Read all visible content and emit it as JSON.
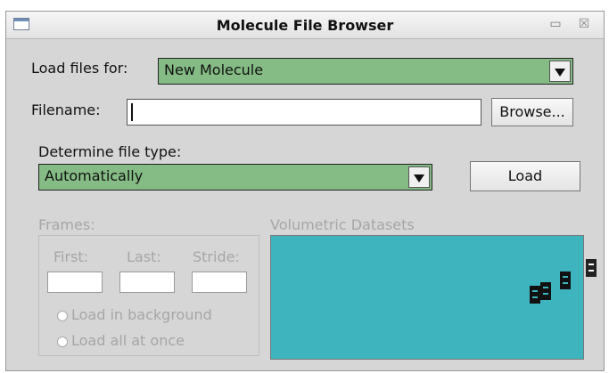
{
  "window": {
    "title": "Molecule File Browser",
    "minimize_glyph": "▭",
    "close_glyph": "☒"
  },
  "load_for": {
    "label": "Load files for:",
    "selected": "New Molecule"
  },
  "filename": {
    "label": "Filename:",
    "value": "",
    "browse_label": "Browse..."
  },
  "file_type": {
    "label": "Determine file type:",
    "selected": "Automatically",
    "load_label": "Load"
  },
  "frames": {
    "label": "Frames:",
    "first_label": "First:",
    "last_label": "Last:",
    "stride_label": "Stride:",
    "first_value": "",
    "last_value": "",
    "stride_value": "",
    "load_background_label": "Load in background",
    "load_all_label": "Load all at once"
  },
  "volumetric": {
    "label": "Volumetric Datasets"
  },
  "colors": {
    "combo_fill": "#85bc85",
    "volumetric_fill": "#3eb4bf",
    "window_bg": "#d6d6d6",
    "disabled_text": "#a6a6a6"
  },
  "icons": {
    "window_icon": "window-icon",
    "minimize": "minimize-icon",
    "close": "close-icon",
    "dropdown": "chevron-down-icon",
    "radio": "radio-icon"
  }
}
